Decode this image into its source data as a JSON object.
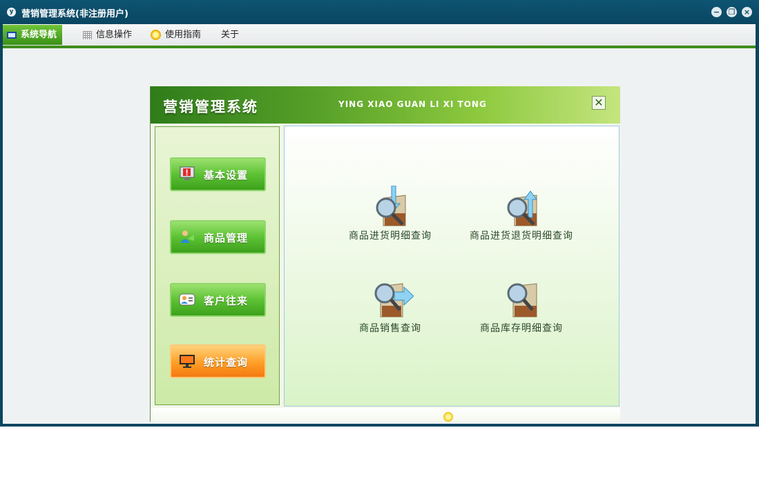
{
  "window": {
    "title": "营销管理系统(非注册用户)",
    "app_icon_text": "y"
  },
  "menubar": {
    "items": [
      {
        "label": "系统导航",
        "icon": "monitor-icon",
        "active": true
      },
      {
        "label": "信息操作",
        "icon": "grid-icon",
        "active": false
      },
      {
        "label": "使用指南",
        "icon": "guide-icon",
        "active": false
      },
      {
        "label": "关于",
        "icon": "",
        "active": false
      }
    ]
  },
  "panel": {
    "title": "营销管理系统",
    "pinyin": "YING XIAO GUAN LI XI TONG",
    "close_symbol": "✕",
    "nav": [
      {
        "label": "基本设置",
        "icon": "settings-alert-icon",
        "active": false
      },
      {
        "label": "商品管理",
        "icon": "product-icon",
        "active": false
      },
      {
        "label": "客户往来",
        "icon": "contact-card-icon",
        "active": false
      },
      {
        "label": "统计查询",
        "icon": "monitor-stats-icon",
        "active": true
      }
    ],
    "queries": [
      {
        "label": "商品进货明细查询",
        "icon": "purchase-detail-icon"
      },
      {
        "label": "商品进货退货明细查询",
        "icon": "purchase-return-icon"
      },
      {
        "label": "商品销售查询",
        "icon": "sales-query-icon"
      },
      {
        "label": "商品库存明细查询",
        "icon": "inventory-query-icon"
      }
    ]
  },
  "colors": {
    "titlebar": "#0b4560",
    "accent_green": "#3e8d1c",
    "active_orange": "#ff9e26"
  }
}
